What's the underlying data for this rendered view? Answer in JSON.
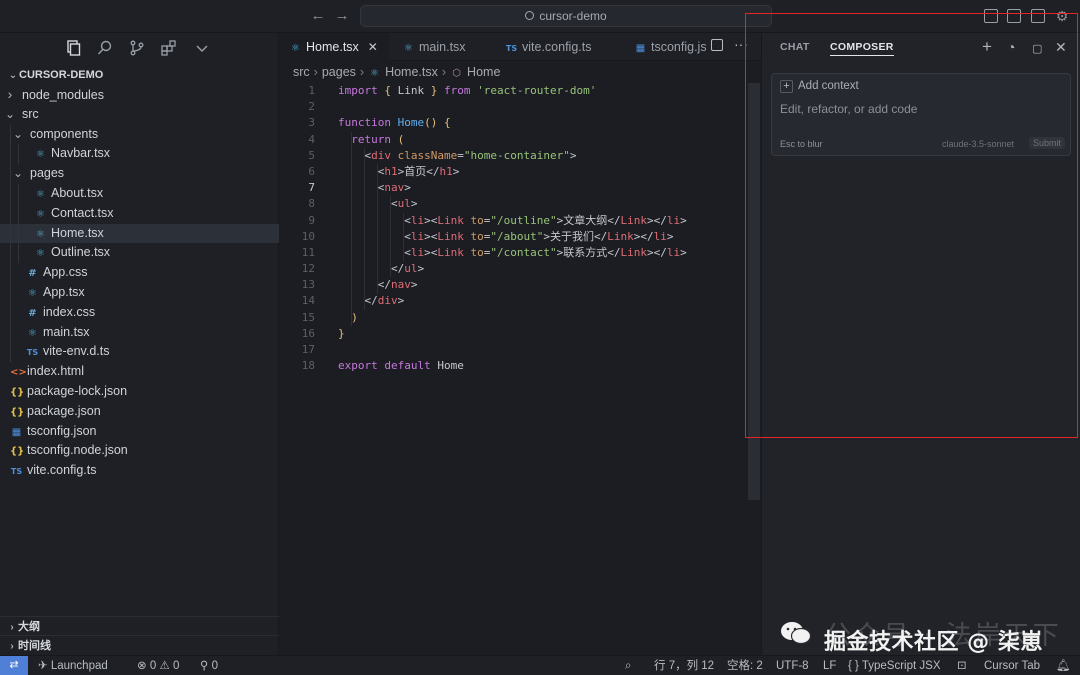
{
  "titlebar": {
    "search_label": "cursor-demo",
    "back_icon": "arrow-left-icon",
    "forward_icon": "arrow-right-icon"
  },
  "sidebar": {
    "section_title": "CURSOR-DEMO",
    "tree": [
      {
        "label": "node_modules",
        "kind": "folder",
        "expanded": false,
        "depth": 0
      },
      {
        "label": "src",
        "kind": "folder",
        "expanded": true,
        "depth": 0
      },
      {
        "label": "components",
        "kind": "folder",
        "expanded": true,
        "depth": 1
      },
      {
        "label": "Navbar.tsx",
        "kind": "react",
        "depth": 2
      },
      {
        "label": "pages",
        "kind": "folder",
        "expanded": true,
        "depth": 1
      },
      {
        "label": "About.tsx",
        "kind": "react",
        "depth": 2
      },
      {
        "label": "Contact.tsx",
        "kind": "react",
        "depth": 2
      },
      {
        "label": "Home.tsx",
        "kind": "react",
        "depth": 2,
        "active": true
      },
      {
        "label": "Outline.tsx",
        "kind": "react",
        "depth": 2
      },
      {
        "label": "App.css",
        "kind": "css",
        "depth": 1
      },
      {
        "label": "App.tsx",
        "kind": "react",
        "depth": 1
      },
      {
        "label": "index.css",
        "kind": "css",
        "depth": 1
      },
      {
        "label": "main.tsx",
        "kind": "react",
        "depth": 1
      },
      {
        "label": "vite-env.d.ts",
        "kind": "ts",
        "depth": 1
      },
      {
        "label": "index.html",
        "kind": "html",
        "depth": 0
      },
      {
        "label": "package-lock.json",
        "kind": "json",
        "depth": 0
      },
      {
        "label": "package.json",
        "kind": "json",
        "depth": 0
      },
      {
        "label": "tsconfig.json",
        "kind": "tsconfig",
        "depth": 0
      },
      {
        "label": "tsconfig.node.json",
        "kind": "json",
        "depth": 0
      },
      {
        "label": "vite.config.ts",
        "kind": "ts",
        "depth": 0
      }
    ],
    "outline_label": "大纲",
    "timeline_label": "时间线"
  },
  "editor": {
    "tabs": [
      {
        "label": "Home.tsx",
        "active": true,
        "icon": "react"
      },
      {
        "label": "main.tsx",
        "active": false,
        "icon": "react"
      },
      {
        "label": "vite.config.ts",
        "active": false,
        "icon": "ts"
      },
      {
        "label": "tsconfig.js",
        "active": false,
        "icon": "tsconfig"
      }
    ],
    "breadcrumb": [
      "src",
      "pages",
      "Home.tsx",
      "Home"
    ],
    "current_line": 7,
    "lines": [
      [
        [
          "kw",
          "import "
        ],
        [
          "brk",
          "{ "
        ],
        [
          "id",
          "Link "
        ],
        [
          "brk",
          "} "
        ],
        [
          "kw",
          "from "
        ],
        [
          "str",
          "'react-router-dom'"
        ]
      ],
      [],
      [
        [
          "kw",
          "function "
        ],
        [
          "fn",
          "Home"
        ],
        [
          "brk",
          "() {"
        ]
      ],
      [
        [
          "pn",
          "  "
        ],
        [
          "kw",
          "return "
        ],
        [
          "brk",
          "("
        ]
      ],
      [
        [
          "pn",
          "    <"
        ],
        [
          "tag",
          "div "
        ],
        [
          "attr",
          "className"
        ],
        [
          "pn",
          "="
        ],
        [
          "str",
          "\"home-container\""
        ],
        [
          "pn",
          ">"
        ]
      ],
      [
        [
          "pn",
          "      <"
        ],
        [
          "tag",
          "h1"
        ],
        [
          "pn",
          ">首页</"
        ],
        [
          "tag",
          "h1"
        ],
        [
          "pn",
          ">"
        ]
      ],
      [
        [
          "pn",
          "      <"
        ],
        [
          "tag",
          "nav"
        ],
        [
          "pn",
          ">"
        ]
      ],
      [
        [
          "pn",
          "        <"
        ],
        [
          "tag",
          "ul"
        ],
        [
          "pn",
          ">"
        ]
      ],
      [
        [
          "pn",
          "          <"
        ],
        [
          "tag",
          "li"
        ],
        [
          "pn",
          "><"
        ],
        [
          "tag",
          "Link "
        ],
        [
          "attr",
          "to"
        ],
        [
          "pn",
          "="
        ],
        [
          "str",
          "\"/outline\""
        ],
        [
          "pn",
          ">文章大纲</"
        ],
        [
          "tag",
          "Link"
        ],
        [
          "pn",
          "></"
        ],
        [
          "tag",
          "li"
        ],
        [
          "pn",
          ">"
        ]
      ],
      [
        [
          "pn",
          "          <"
        ],
        [
          "tag",
          "li"
        ],
        [
          "pn",
          "><"
        ],
        [
          "tag",
          "Link "
        ],
        [
          "attr",
          "to"
        ],
        [
          "pn",
          "="
        ],
        [
          "str",
          "\"/about\""
        ],
        [
          "pn",
          ">关于我们</"
        ],
        [
          "tag",
          "Link"
        ],
        [
          "pn",
          "></"
        ],
        [
          "tag",
          "li"
        ],
        [
          "pn",
          ">"
        ]
      ],
      [
        [
          "pn",
          "          <"
        ],
        [
          "tag",
          "li"
        ],
        [
          "pn",
          "><"
        ],
        [
          "tag",
          "Link "
        ],
        [
          "attr",
          "to"
        ],
        [
          "pn",
          "="
        ],
        [
          "str",
          "\"/contact\""
        ],
        [
          "pn",
          ">联系方式</"
        ],
        [
          "tag",
          "Link"
        ],
        [
          "pn",
          "></"
        ],
        [
          "tag",
          "li"
        ],
        [
          "pn",
          ">"
        ]
      ],
      [
        [
          "pn",
          "        </"
        ],
        [
          "tag",
          "ul"
        ],
        [
          "pn",
          ">"
        ]
      ],
      [
        [
          "pn",
          "      </"
        ],
        [
          "tag",
          "nav"
        ],
        [
          "pn",
          ">"
        ]
      ],
      [
        [
          "pn",
          "    </"
        ],
        [
          "tag",
          "div"
        ],
        [
          "pn",
          ">"
        ]
      ],
      [
        [
          "pn",
          "  "
        ],
        [
          "brk",
          ")"
        ]
      ],
      [
        [
          "brk",
          "}"
        ]
      ],
      [],
      [
        [
          "kw",
          "export "
        ],
        [
          "kw",
          "default "
        ],
        [
          "id",
          "Home"
        ]
      ]
    ]
  },
  "panel": {
    "tab_chat": "CHAT",
    "tab_composer": "COMPOSER",
    "add_context": "Add context",
    "placeholder": "Edit, refactor, or add code",
    "esc_hint": "Esc to blur",
    "model": "claude-3.5-sonnet",
    "submit": "Submit"
  },
  "watermark": {
    "back_text": "公众号 · 法岸天下",
    "front_text": "掘金技术社区 @ 柒崽"
  },
  "statusbar": {
    "launchpad": "Launchpad",
    "errors": "0",
    "warnings": "0",
    "ports": "0",
    "position": "行 7，列 12",
    "indent": "空格: 2",
    "encoding": "UTF-8",
    "eol": "LF",
    "language": "TypeScript JSX",
    "cursor_tab": "Cursor Tab"
  },
  "colors": {
    "accent": "#4f7fd6",
    "highlight_box": "#e32526",
    "keyword": "#c678dd",
    "function": "#61afef",
    "string": "#98c379",
    "tag": "#e06c75",
    "attribute": "#d19a66"
  }
}
